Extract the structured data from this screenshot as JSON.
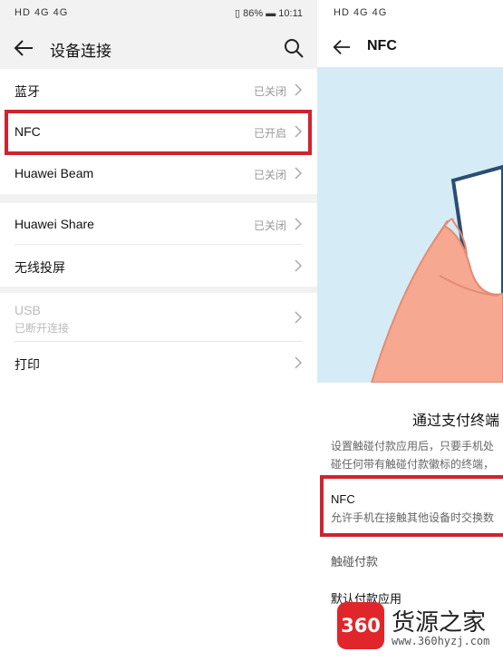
{
  "left": {
    "status": {
      "left": "HD 4G 4G",
      "battery": "86%",
      "time": "10:11"
    },
    "title": "设备连接",
    "group1": [
      {
        "label": "蓝牙",
        "value": "已关闭"
      },
      {
        "label": "NFC",
        "value": "已开启"
      },
      {
        "label": "Huawei Beam",
        "value": "已关闭"
      }
    ],
    "group2": [
      {
        "label": "Huawei Share",
        "value": "已关闭"
      },
      {
        "label": "无线投屏",
        "value": ""
      }
    ],
    "group3": [
      {
        "label": "USB",
        "sub": "已断开连接"
      },
      {
        "label": "打印",
        "value": ""
      }
    ]
  },
  "right": {
    "status": {
      "left": "HD 4G 4G"
    },
    "title": "NFC",
    "heading": "通过支付终端",
    "desc_line1": "设置触碰付款应用后，只要手机处",
    "desc_line2": "碰任何带有触碰付款徽标的终端，",
    "nfc_label": "NFC",
    "nfc_sub": "允许手机在接触其他设备时交换数",
    "pay_label": "触碰付款",
    "default_label": "默认付款应用"
  },
  "watermark": {
    "logo": "360",
    "name": "货源之家",
    "url": "www.360hyzj.com"
  },
  "colors": {
    "highlight": "#d0232f",
    "illustration_bg": "#d5ecf6",
    "hand": "#f6a891"
  }
}
